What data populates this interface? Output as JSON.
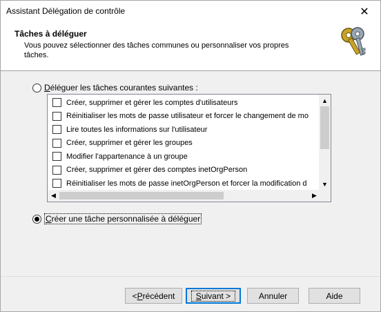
{
  "window": {
    "title": "Assistant Délégation de contrôle",
    "close_glyph": "✕"
  },
  "header": {
    "title": "Tâches à déléguer",
    "description": "Vous pouvez sélectionner des tâches communes ou personnaliser vos propres tâches.",
    "icon": "keys-icon"
  },
  "options": {
    "delegate_common": {
      "selected": false,
      "label_prefix": "",
      "label_accel": "D",
      "label_rest": "éléguer les tâches courantes suivantes :"
    },
    "create_custom": {
      "selected": true,
      "label_accel": "C",
      "label_rest": "réer une tâche personnalisée à déléguer"
    }
  },
  "tasks": [
    {
      "label": "Créer, supprimer et gérer les comptes d'utilisateurs",
      "checked": false
    },
    {
      "label": "Réinitialiser les mots de passe utilisateur et forcer le changement de mo",
      "checked": false
    },
    {
      "label": "Lire toutes les informations sur l'utilisateur",
      "checked": false
    },
    {
      "label": "Créer, supprimer et gérer les groupes",
      "checked": false
    },
    {
      "label": "Modifier l'appartenance à un groupe",
      "checked": false
    },
    {
      "label": "Créer, supprimer et gérer des comptes inetOrgPerson",
      "checked": false
    },
    {
      "label": "Réinitialiser les mots de passe inetOrgPerson et forcer la modification d",
      "checked": false
    }
  ],
  "scroll_glyphs": {
    "up": "▲",
    "down": "▼",
    "left": "◀",
    "right": "▶"
  },
  "buttons": {
    "back": {
      "prefix": "< ",
      "accel": "P",
      "rest": "récédent"
    },
    "next": {
      "accel": "S",
      "rest": "uivant >"
    },
    "cancel": "Annuler",
    "help": "Aide"
  },
  "colors": {
    "focus": "#0078d7",
    "button_face": "#e1e1e1",
    "dialog_bg": "#f0f0f0"
  }
}
